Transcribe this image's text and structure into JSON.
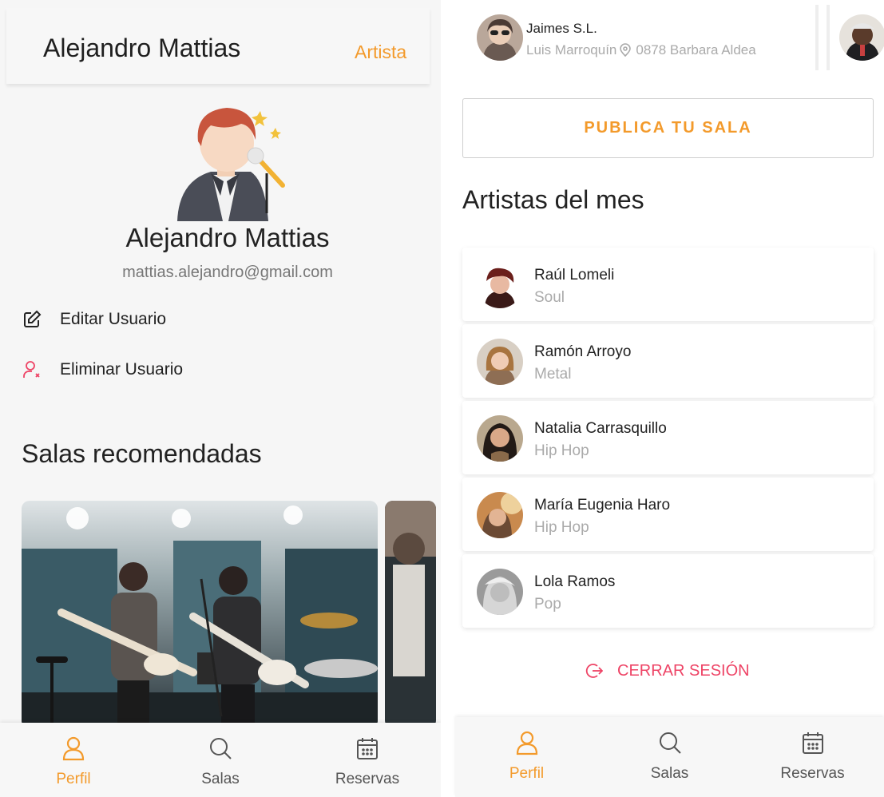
{
  "left": {
    "header": {
      "name": "Alejandro Mattias",
      "role": "Artista"
    },
    "profile": {
      "name": "Alejandro Mattias",
      "email": "mattias.alejandro@gmail.com"
    },
    "actions": {
      "edit": "Editar Usuario",
      "delete": "Eliminar Usuario"
    },
    "salas_title": "Salas recomendadas"
  },
  "right": {
    "stories": [
      {
        "name": "Jaimes S.L.",
        "owner": "Luis Marroquín",
        "address": "0878 Barbara Aldea"
      }
    ],
    "publish_button": "PUBLICA TU SALA",
    "artists_title": "Artistas del mes",
    "artists": [
      {
        "name": "Raúl Lomeli",
        "genre": "Soul"
      },
      {
        "name": "Ramón Arroyo",
        "genre": "Metal"
      },
      {
        "name": "Natalia Carrasquillo",
        "genre": "Hip Hop"
      },
      {
        "name": "María Eugenia Haro",
        "genre": "Hip Hop"
      },
      {
        "name": "Lola Ramos",
        "genre": "Pop"
      }
    ],
    "logout": "CERRAR SESIÓN"
  },
  "nav": {
    "items": [
      {
        "label": "Perfil",
        "icon": "user-icon",
        "active": true
      },
      {
        "label": "Salas",
        "icon": "search-icon",
        "active": false
      },
      {
        "label": "Reservas",
        "icon": "calendar-icon",
        "active": false
      }
    ]
  },
  "colors": {
    "accent": "#f39a2b",
    "danger": "#ee4466",
    "muted": "#aaaaaa"
  }
}
